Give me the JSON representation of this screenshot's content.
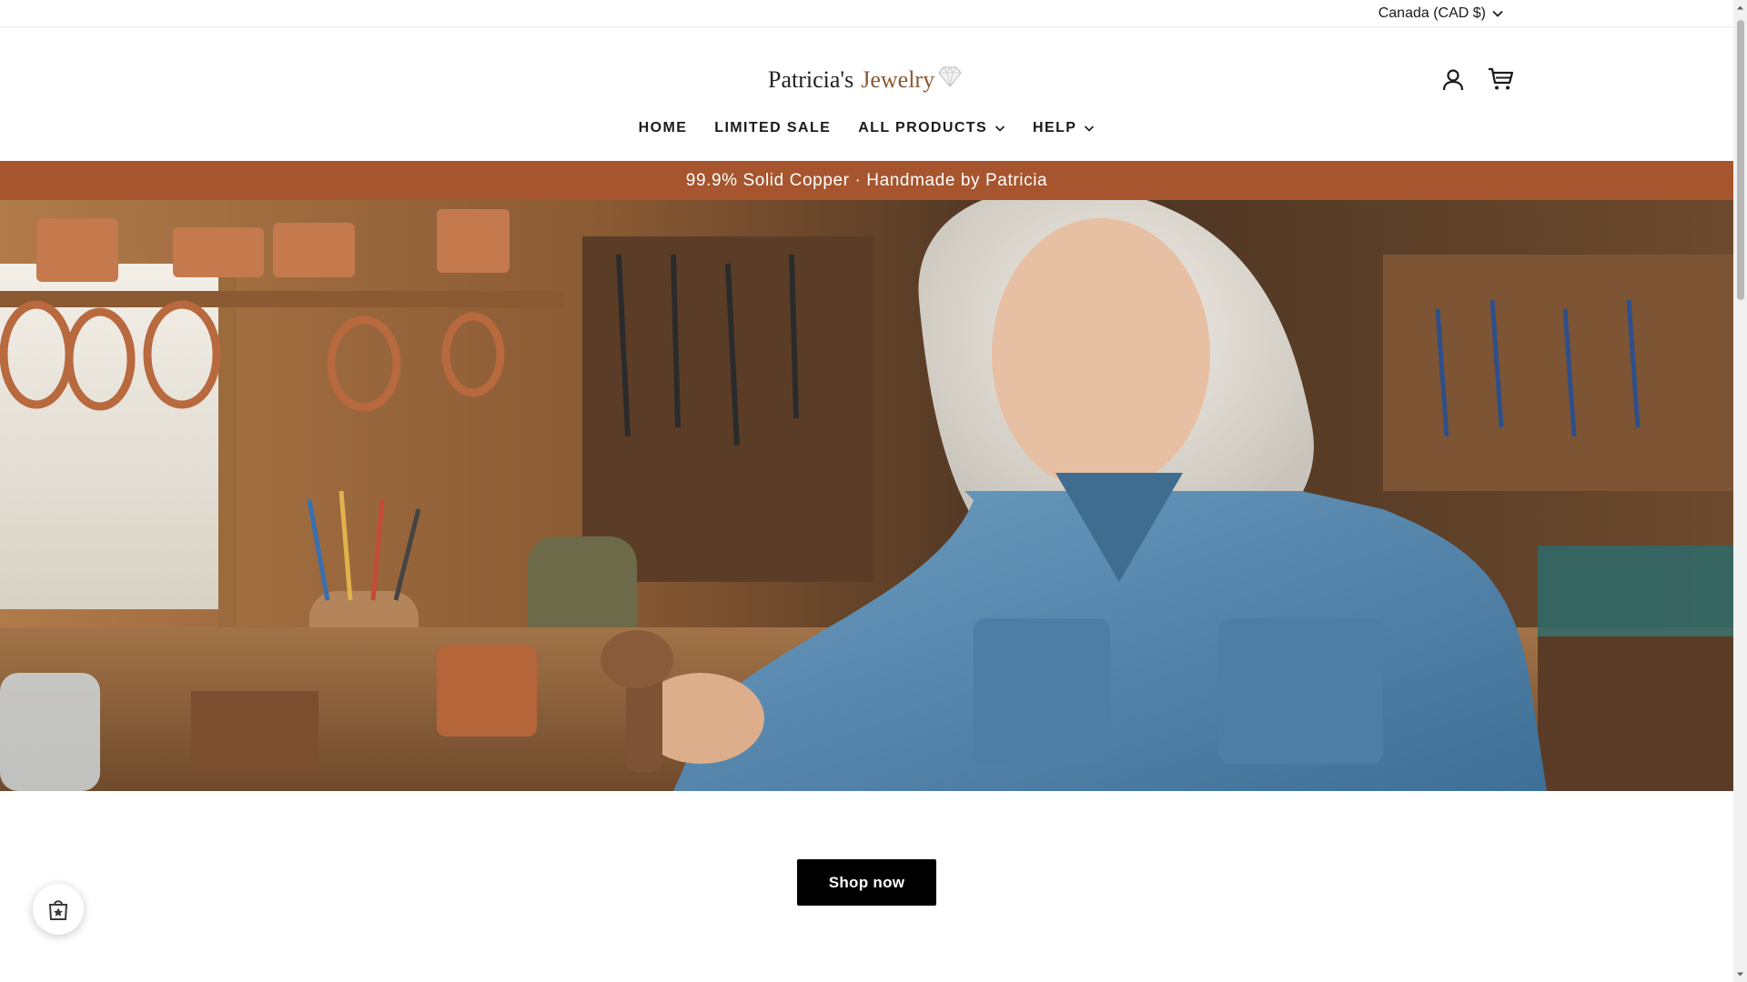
{
  "utility": {
    "currency_label": "Canada (CAD $)"
  },
  "header": {
    "logo_text_a": "Patricia's",
    "logo_text_b": "Jewelry",
    "account_icon": "account-icon",
    "cart_icon": "cart-icon"
  },
  "nav": {
    "items": [
      {
        "label": "HOME",
        "dropdown": false
      },
      {
        "label": "LIMITED SALE",
        "dropdown": false
      },
      {
        "label": "ALL PRODUCTS",
        "dropdown": true
      },
      {
        "label": "HELP",
        "dropdown": true
      }
    ]
  },
  "announcement": {
    "text": "99.9% Solid Copper · Handmade by Patricia",
    "color": "#a7552e"
  },
  "hero": {
    "image": "hero-workshop-image"
  },
  "cta": {
    "label": "Shop now"
  },
  "floating": {
    "icon": "shopping-bag-star-icon"
  },
  "colors": {
    "brand": "#a7552e",
    "button": "#000000",
    "logo_accent": "#8a5a35"
  }
}
